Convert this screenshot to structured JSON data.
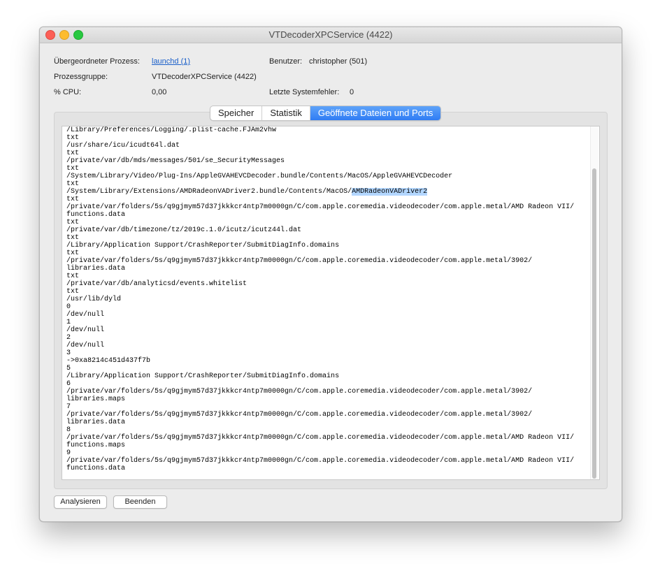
{
  "window": {
    "title": "VTDecoderXPCService (4422)"
  },
  "info": {
    "parent_label": "Übergeordneter Prozess:",
    "parent_value": "launchd (1)",
    "user_label": "Benutzer:",
    "user_value": "christopher (501)",
    "group_label": "Prozessgruppe:",
    "group_value": "VTDecoderXPCService (4422)",
    "cpu_label": "% CPU:",
    "cpu_value": "0,00",
    "faults_label": "Letzte Systemfehler:",
    "faults_value": "0"
  },
  "tabs": [
    {
      "label": "Speicher",
      "active": false
    },
    {
      "label": "Statistik",
      "active": false
    },
    {
      "label": "Geöffnete Dateien und Ports",
      "active": true
    }
  ],
  "open_files": {
    "lines_before_selection": "/Library/Preferences/Logging/.plist-cache.FJAm2vhw\ntxt\n/usr/share/icu/icudt64l.dat\ntxt\n/private/var/db/mds/messages/501/se_SecurityMessages\ntxt\n/System/Library/Video/Plug-Ins/AppleGVAHEVCDecoder.bundle/Contents/MacOS/AppleGVAHEVCDecoder\ntxt\n/System/Library/Extensions/AMDRadeonVADriver2.bundle/Contents/MacOS/",
    "selected_text": "AMDRadeonVADriver2",
    "lines_after_selection": "\ntxt\n/private/var/folders/5s/q9gjmym57d37jkkkcr4ntp7m0000gn/C/com.apple.coremedia.videodecoder/com.apple.metal/AMD Radeon VII/\nfunctions.data\ntxt\n/private/var/db/timezone/tz/2019c.1.0/icutz/icutz44l.dat\ntxt\n/Library/Application Support/CrashReporter/SubmitDiagInfo.domains\ntxt\n/private/var/folders/5s/q9gjmym57d37jkkkcr4ntp7m0000gn/C/com.apple.coremedia.videodecoder/com.apple.metal/3902/\nlibraries.data\ntxt\n/private/var/db/analyticsd/events.whitelist\ntxt\n/usr/lib/dyld\n0\n/dev/null\n1\n/dev/null\n2\n/dev/null\n3\n->0xa8214c451d437f7b\n5\n/Library/Application Support/CrashReporter/SubmitDiagInfo.domains\n6\n/private/var/folders/5s/q9gjmym57d37jkkkcr4ntp7m0000gn/C/com.apple.coremedia.videodecoder/com.apple.metal/3902/\nlibraries.maps\n7\n/private/var/folders/5s/q9gjmym57d37jkkkcr4ntp7m0000gn/C/com.apple.coremedia.videodecoder/com.apple.metal/3902/\nlibraries.data\n8\n/private/var/folders/5s/q9gjmym57d37jkkkcr4ntp7m0000gn/C/com.apple.coremedia.videodecoder/com.apple.metal/AMD Radeon VII/\nfunctions.maps\n9\n/private/var/folders/5s/q9gjmym57d37jkkkcr4ntp7m0000gn/C/com.apple.coremedia.videodecoder/com.apple.metal/AMD Radeon VII/\nfunctions.data"
  },
  "buttons": {
    "sample": "Analysieren",
    "quit": "Beenden"
  },
  "colors": {
    "accent": "#2f7cf4",
    "link": "#1a5fc9",
    "selection": "#b3d7ff",
    "close": "#fc5f57",
    "minimize": "#fdbc2e",
    "zoom": "#28c840"
  }
}
